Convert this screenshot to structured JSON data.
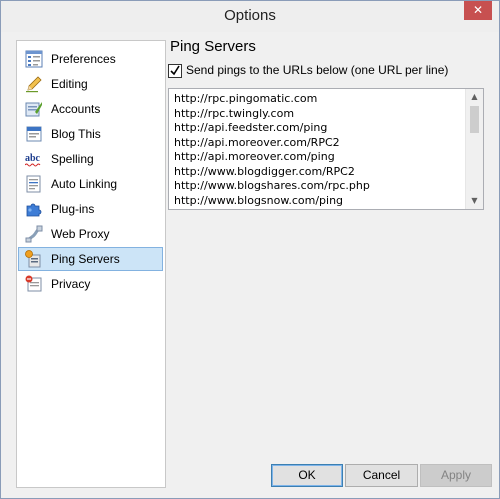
{
  "window": {
    "title": "Options",
    "close_glyph": "✕"
  },
  "sidebar": {
    "items": [
      {
        "label": "Preferences",
        "icon": "preferences-icon",
        "selected": false
      },
      {
        "label": "Editing",
        "icon": "pencil-icon",
        "selected": false
      },
      {
        "label": "Accounts",
        "icon": "accounts-icon",
        "selected": false
      },
      {
        "label": "Blog This",
        "icon": "blog-this-icon",
        "selected": false
      },
      {
        "label": "Spelling",
        "icon": "spelling-abc-icon",
        "selected": false
      },
      {
        "label": "Auto Linking",
        "icon": "auto-linking-icon",
        "selected": false
      },
      {
        "label": "Plug-ins",
        "icon": "puzzle-piece-icon",
        "selected": false
      },
      {
        "label": "Web Proxy",
        "icon": "web-proxy-icon",
        "selected": false
      },
      {
        "label": "Ping Servers",
        "icon": "ping-servers-icon",
        "selected": true
      },
      {
        "label": "Privacy",
        "icon": "privacy-icon",
        "selected": false
      }
    ]
  },
  "panel": {
    "title": "Ping Servers",
    "send_pings": {
      "checked": true,
      "label": "Send pings to the URLs below (one URL per line)"
    },
    "urls": [
      "http://rpc.pingomatic.com",
      "http://rpc.twingly.com",
      "http://api.feedster.com/ping",
      "http://api.moreover.com/RPC2",
      "http://api.moreover.com/ping",
      "http://www.blogdigger.com/RPC2",
      "http://www.blogshares.com/rpc.php",
      "http://www.blogsnow.com/ping"
    ]
  },
  "buttons": {
    "ok": "OK",
    "cancel": "Cancel",
    "apply": "Apply"
  },
  "colors": {
    "selection": "#cce4f7",
    "selection_border": "#83b2e0",
    "close_button": "#c75050",
    "window_border": "#8a9cb8"
  }
}
